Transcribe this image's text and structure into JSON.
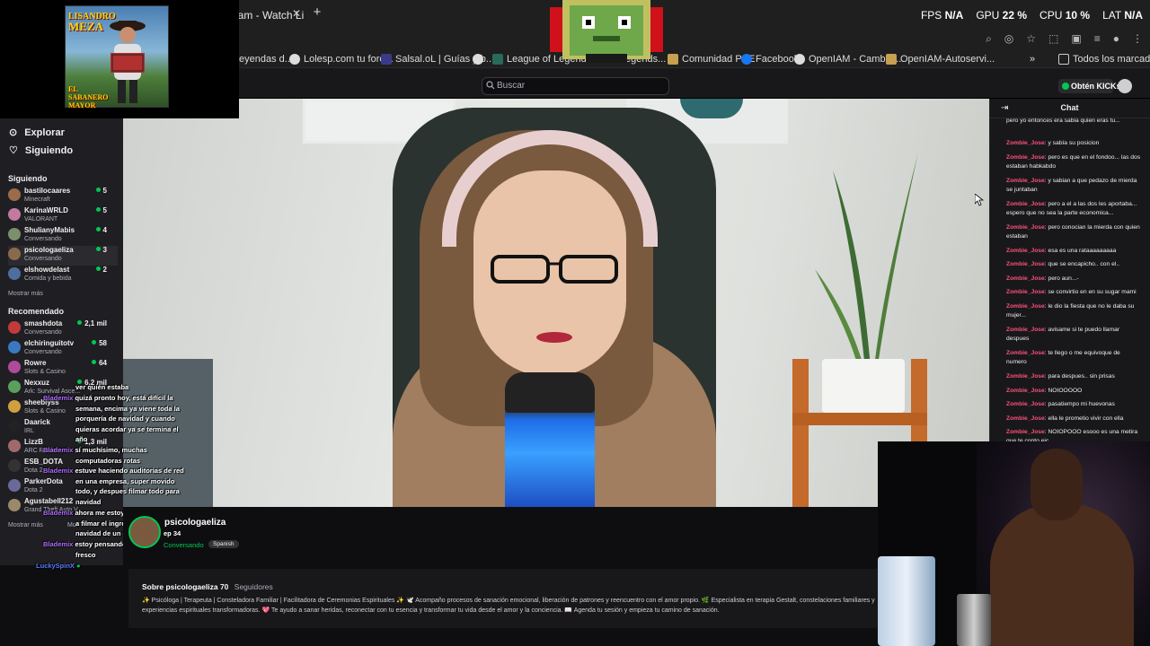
{
  "browser": {
    "tab_title": "eam - Watch Li",
    "stats": [
      {
        "label": "FPS",
        "value": "N/A"
      },
      {
        "label": "GPU",
        "value": "22 %"
      },
      {
        "label": "CPU",
        "value": "10 %"
      },
      {
        "label": "LAT",
        "value": "N/A"
      }
    ],
    "bookmarks": [
      {
        "label": "eyendas d...",
        "icon": "folder-icon"
      },
      {
        "label": "Lolesp.com tu foro...",
        "icon": "globe-icon"
      },
      {
        "label": "Salsal.oL | Guías y b...",
        "icon": "s-icon"
      },
      {
        "label": "",
        "icon": "lol-icon"
      },
      {
        "label": "League of Legends",
        "icon": "lol-icon"
      },
      {
        "label": "egends...",
        "icon": "lol-icon"
      },
      {
        "label": "Comunidad PBE",
        "icon": "lol-icon"
      },
      {
        "label": "Facebook",
        "icon": "facebook-icon"
      },
      {
        "label": "OpenIAM - Cambiar...",
        "icon": "globe-icon"
      },
      {
        "label": "OpenIAM-Autoservi...",
        "icon": "openiam-icon"
      }
    ],
    "bookmarks_more": "»",
    "all_bookmarks": "Todos los marcadores"
  },
  "twitch": {
    "search_placeholder": "Buscar",
    "kicks_label": "Obtén KICKs"
  },
  "album": {
    "title_line1": "LISANDRO",
    "title_line2": "MEZA",
    "subtitle_line1": "EL",
    "subtitle_line2": "SABANERO",
    "subtitle_line3": "MAYOR"
  },
  "sidebar": {
    "explore": "Explorar",
    "following": "Siguiendo",
    "following_header": "Siguiendo",
    "followed": [
      {
        "name": "bastilocaares",
        "game": "Minecraft",
        "viewers": "5",
        "color": "#9b6b4a"
      },
      {
        "name": "KarinaWRLD",
        "game": "VALORANT",
        "viewers": "5",
        "color": "#c27aa0"
      },
      {
        "name": "ShulianyMabis",
        "game": "Conversando",
        "viewers": "4",
        "color": "#7a8f6a"
      },
      {
        "name": "psicologaeliza",
        "game": "Conversando",
        "viewers": "3",
        "color": "#8a6a4d"
      },
      {
        "name": "elshowdelast",
        "game": "Comida y bebida",
        "viewers": "2",
        "color": "#4e6e9e"
      }
    ],
    "show_more": "Mostrar más",
    "recommended_header": "Recomendado",
    "recommended": [
      {
        "name": "smashdota",
        "game": "Conversando",
        "viewers": "2,1 mil",
        "color": "#c23b3b"
      },
      {
        "name": "elchiringuitotv",
        "game": "Conversando",
        "viewers": "58",
        "color": "#3a78c2"
      },
      {
        "name": "Rowre",
        "game": "Slots & Casino",
        "viewers": "64",
        "color": "#b04a9a"
      },
      {
        "name": "Nexxuz",
        "game": "Ark: Survival Asce...",
        "viewers": "6,2 mil",
        "color": "#5aa05a"
      },
      {
        "name": "sheeblyss",
        "game": "Slots & Casino",
        "viewers": "",
        "color": "#d0a040"
      },
      {
        "name": "Daarick",
        "game": "IRL",
        "viewers": "",
        "color": "#222222"
      },
      {
        "name": "LizzB",
        "game": "ARC Raiders",
        "viewers": "1,3 mil",
        "color": "#a06a6a"
      },
      {
        "name": "ESB_DOTA",
        "game": "Dota 2",
        "viewers": "",
        "color": "#333333"
      },
      {
        "name": "ParkerDota",
        "game": "Dota 2",
        "viewers": "",
        "color": "#6a6a9a"
      },
      {
        "name": "Agustabell212",
        "game": "Grand Theft Auto V",
        "viewers": "",
        "color": "#9a8a6a"
      }
    ],
    "show_more_2": "Mostrar más",
    "show_more_3": "Mo"
  },
  "overlay_chat": [
    {
      "user": "",
      "text": "ver quién estaba"
    },
    {
      "user": "Blademix",
      "text": "quizá pronto hoy, está difícil la"
    },
    {
      "user": "",
      "text": "semana, encima ya viene toda la"
    },
    {
      "user": "",
      "text": "porquería de navidad y cuando"
    },
    {
      "user": "",
      "text": "quieras acordar ya se termina el"
    },
    {
      "user": "",
      "text": "año"
    },
    {
      "user": "Blademix",
      "text": "sí muchísimo, muchas"
    },
    {
      "user": "",
      "text": "computadoras rotas"
    },
    {
      "user": "Blademix",
      "text": "estuve haciendo auditorias de red"
    },
    {
      "user": "",
      "text": "en una empresa, super movido"
    },
    {
      "user": "",
      "text": "todo, y despues filmar todo para"
    },
    {
      "user": "",
      "text": "navidad"
    },
    {
      "user": "Blademix",
      "text": "ahora me estoy preparando para ir"
    },
    {
      "user": "",
      "text": "a filmar el ingreso de carbolitos de"
    },
    {
      "user": "",
      "text": "navidad de un colegio"
    },
    {
      "user": "Blademix",
      "text": "estoy pensando si el domingo o"
    },
    {
      "user": "",
      "text": "fresco"
    },
    {
      "user": "LuckySpinX",
      "text": ""
    }
  ],
  "channel": {
    "name": "psicologaeliza",
    "stream_title": "ep 34",
    "category": "Conversando",
    "language": "Spanish",
    "about_title": "Sobre psicologaeliza",
    "followers_count": "70",
    "followers_label": "Seguidores",
    "about_text": "✨ Psicóloga | Terapeuta | Consteladora Familiar | Facilitadora de Ceremonias Espirituales ✨ 🕊️ Acompaño procesos de sanación emocional, liberación de patrones y reencuentro con el amor propio. 🌿 Especialista en terapia Gestalt, constelaciones familiares y experiencias espirituales transformadoras. 💖 Te ayudo a sanar heridas, reconectar con tu esencia y transformar tu vida desde el amor y la conciencia. 📖 Agenda tu sesión y empieza tu camino de sanación."
  },
  "chat": {
    "title": "Chat",
    "messages": [
      {
        "user": "",
        "text": "pero yo entonces era sabia quien eras tu..."
      },
      {
        "user": "Zombie_Jose",
        "text": "y sabía su posicion"
      },
      {
        "user": "Zombie_Jose",
        "text": "pero es que en el fondoo... las dos estaban habkabdo"
      },
      {
        "user": "Zombie_Jose",
        "text": "y sabian a que pedazo de mierda se juntaban"
      },
      {
        "user": "Zombie_Jose",
        "text": "pero a el a las dos les aportaba... espero que no sea la parte economica..."
      },
      {
        "user": "Zombie_Jose",
        "text": "pero conocian la mierda con quien estaban"
      },
      {
        "user": "Zombie_Jose",
        "text": "esa es una rataaaaaaaaa"
      },
      {
        "user": "Zombie_Jose",
        "text": "que se encapicho.. con el.."
      },
      {
        "user": "Zombie_Jose",
        "text": "pero aun...-"
      },
      {
        "user": "Zombie_Jose",
        "text": "se convirtio en en su sugar mami"
      },
      {
        "user": "Zombie_Jose",
        "text": "le dio la fiesta que no le daba su mujer..."
      },
      {
        "user": "Zombie_Jose",
        "text": "avisame si te puedo llamar despues"
      },
      {
        "user": "Zombie_Jose",
        "text": "te llego o me equivoque de numero"
      },
      {
        "user": "Zombie_Jose",
        "text": "para despues.. sin prisas"
      },
      {
        "user": "Zombie_Jose",
        "text": "NOIOOOOO"
      },
      {
        "user": "Zombie_Jose",
        "text": "pasatiempo mi huevonas"
      },
      {
        "user": "Zombie_Jose",
        "text": "ella le prometio vivir con ella"
      },
      {
        "user": "Zombie_Jose",
        "text": "NOIOPOOO esooo es una metira que te conto eic"
      }
    ]
  }
}
